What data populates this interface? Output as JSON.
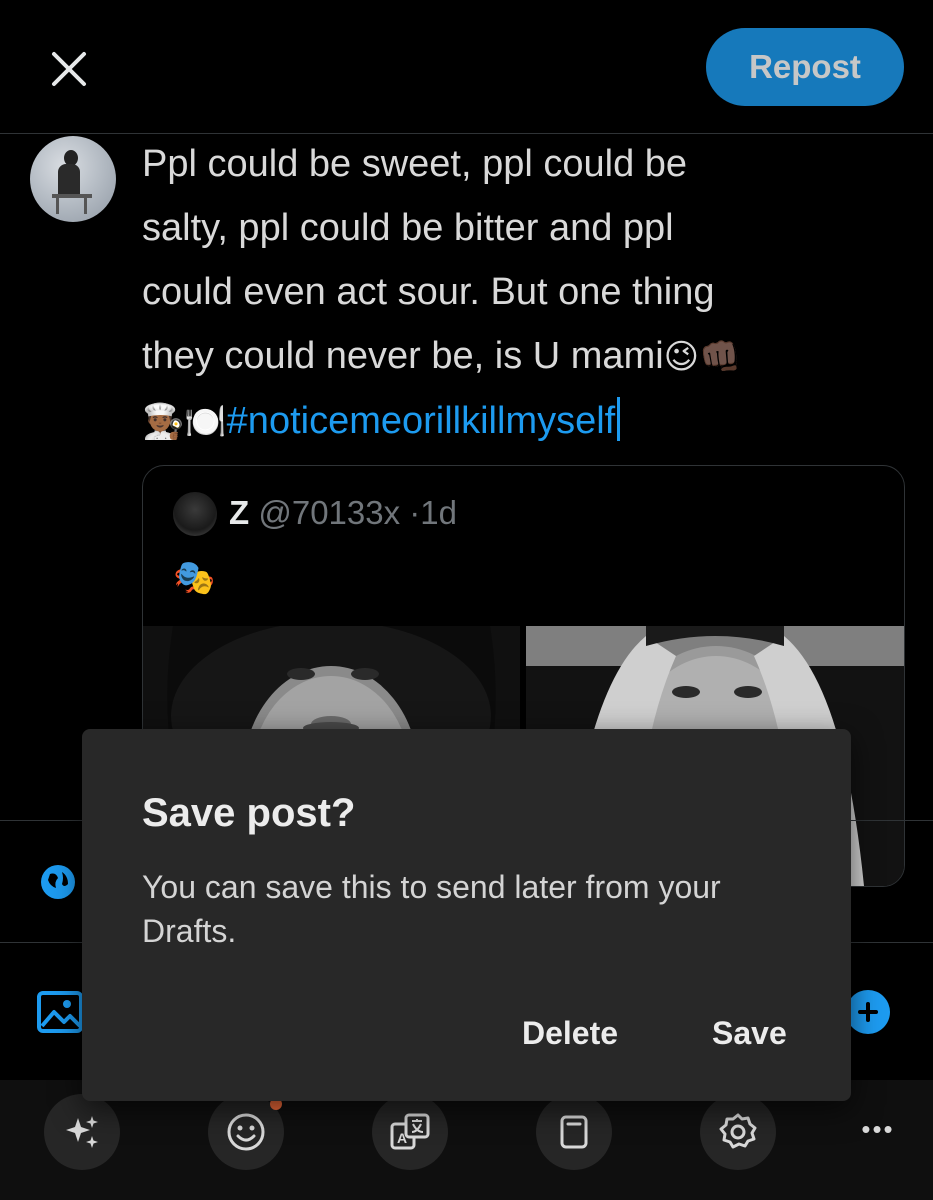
{
  "header": {
    "close_icon": "close-icon",
    "repost_label": "Repost"
  },
  "compose": {
    "line1": "Ppl could be sweet, ppl could be",
    "line2": "salty, ppl could be bitter and ppl",
    "line3": "could even act sour. But one thing",
    "line4_text": "they could never be, is U mami",
    "line4_emojis": "😉👊🏿",
    "line5_emojis": "👨🏾‍🍳🍽️",
    "hashtag": "#noticemeorillkillmyself"
  },
  "quote": {
    "name": "Z",
    "handle": "@70133x",
    "separator": "·",
    "time": "1d",
    "text": "🎭"
  },
  "dialog": {
    "title": "Save post?",
    "message": "You can save this to send later from your Drafts.",
    "delete_label": "Delete",
    "save_label": "Save"
  },
  "toolbar": {
    "items": [
      "sparkle-icon",
      "emoji-icon",
      "translate-icon",
      "draft-icon",
      "settings-icon",
      "more-icon"
    ],
    "more_label": "•••"
  },
  "colors": {
    "accent": "#1d9bf0",
    "background": "#000000",
    "dialog": "#282828",
    "notification_dot": "#f26b3a"
  }
}
